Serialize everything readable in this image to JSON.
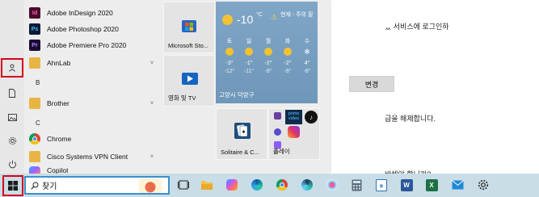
{
  "background": {
    "line1": "ᆻ 서비스에 로그인하",
    "button": "변경",
    "line2": "급을 해제합니다.",
    "line3": "바해야 합니까?"
  },
  "start_menu": {
    "apps": [
      {
        "label": "Adobe InDesign 2020",
        "icon_text": "Id",
        "color": "#4a0b2b"
      },
      {
        "label": "Adobe Photoshop 2020",
        "icon_text": "Ps",
        "color": "#0a1a33"
      },
      {
        "label": "Adobe Premiere Pro 2020",
        "icon_text": "Pr",
        "color": "#1a0a33"
      },
      {
        "label": "AhnLab",
        "icon": "folder-icon"
      },
      {
        "label": "Brother",
        "icon": "folder-icon"
      },
      {
        "label": "Chrome",
        "icon": "chrome-icon"
      },
      {
        "label": "Cisco Systems VPN Client",
        "icon": "folder-icon"
      },
      {
        "label": "Copilot",
        "icon": "copilot-icon"
      }
    ],
    "letters": [
      "B",
      "C"
    ],
    "tiles": {
      "store": "Microsoft Sto...",
      "movies": "영화 및 TV",
      "solitaire": "Solitaire & C...",
      "play": "플레이"
    },
    "weather": {
      "temp": "-10",
      "unit": "°C",
      "condition": "현재 - 주의 필",
      "days": [
        "토",
        "일",
        "월",
        "화",
        "수"
      ],
      "highs": [
        "-3°",
        "-1°",
        "-2°",
        "-2°",
        "4°"
      ],
      "lows": [
        "-12°",
        "-11°",
        "-8°",
        "-8°",
        "-8°"
      ],
      "location": "고양시 덕양구"
    }
  },
  "taskbar": {
    "search_text": "찾기"
  }
}
